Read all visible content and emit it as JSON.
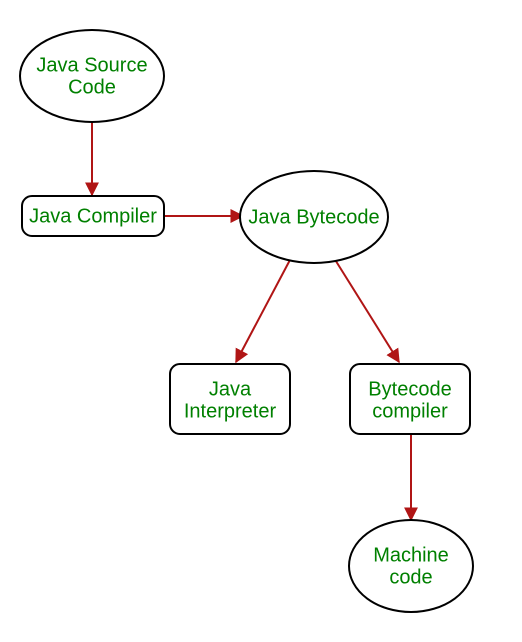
{
  "diagram": {
    "nodes": {
      "source": {
        "label_line1": "Java Source",
        "label_line2": "Code"
      },
      "compiler": {
        "label": "Java Compiler"
      },
      "bytecode": {
        "label": "Java Bytecode"
      },
      "interpreter": {
        "label_line1": "Java",
        "label_line2": "Interpreter"
      },
      "bccompiler": {
        "label_line1": "Bytecode",
        "label_line2": "compiler"
      },
      "machine": {
        "label_line1": "Machine",
        "label_line2": "code"
      }
    },
    "edges": [
      {
        "from": "source",
        "to": "compiler"
      },
      {
        "from": "compiler",
        "to": "bytecode"
      },
      {
        "from": "bytecode",
        "to": "interpreter"
      },
      {
        "from": "bytecode",
        "to": "bccompiler"
      },
      {
        "from": "bccompiler",
        "to": "machine"
      }
    ]
  }
}
